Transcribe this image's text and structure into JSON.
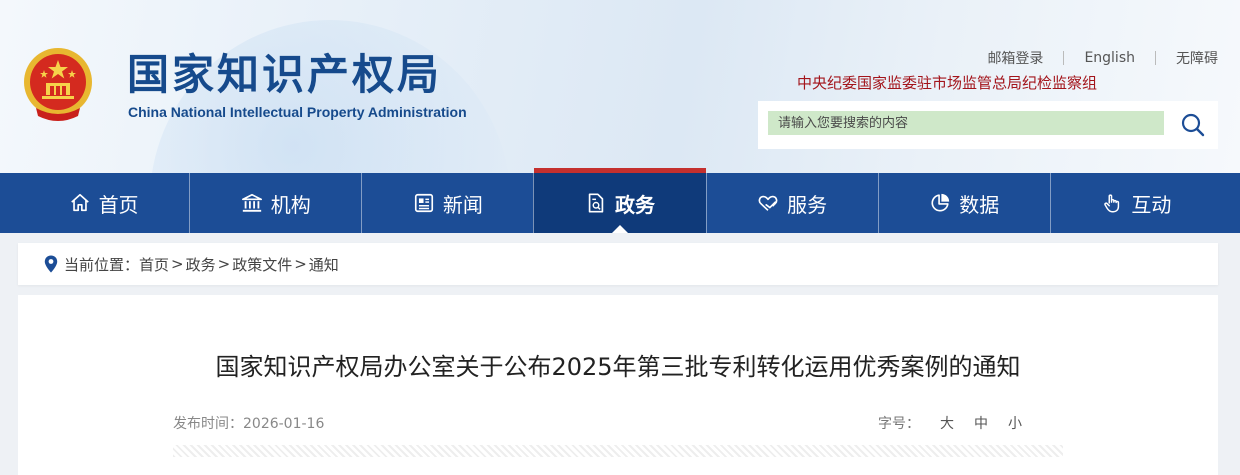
{
  "header": {
    "site_name": "国家知识产权局",
    "site_name_en": "China National Intellectual Property Administration",
    "top_links": [
      {
        "label": "邮箱登录"
      },
      {
        "label": "English"
      },
      {
        "label": "无障碍"
      }
    ],
    "watchdog_link": "中央纪委国家监委驻市场监管总局纪检监察组",
    "search": {
      "placeholder": "请输入您要搜索的内容",
      "value": ""
    }
  },
  "nav": {
    "items": [
      {
        "label": "首页",
        "icon": "home-icon"
      },
      {
        "label": "机构",
        "icon": "building-icon"
      },
      {
        "label": "新闻",
        "icon": "news-icon"
      },
      {
        "label": "政务",
        "icon": "document-icon",
        "active": true
      },
      {
        "label": "服务",
        "icon": "heart-hand-icon"
      },
      {
        "label": "数据",
        "icon": "pie-chart-icon"
      },
      {
        "label": "互动",
        "icon": "hand-pointer-icon"
      }
    ]
  },
  "breadcrumb": {
    "prefix": "当前位置：",
    "items": [
      "首页",
      "政务",
      "政策文件",
      "通知"
    ],
    "separator": ">"
  },
  "article": {
    "title": "国家知识产权局办公室关于公布2025年第三批专利转化运用优秀案例的通知",
    "date_label": "发布时间：",
    "date": "2026-01-16",
    "font_size_label": "字号：",
    "font_sizes": [
      "大",
      "中",
      "小"
    ]
  },
  "colors": {
    "brand_blue": "#1c4d96",
    "active_nav": "#0f3a7a",
    "accent_red": "#c4302e",
    "watchdog_red": "#a3141b"
  }
}
